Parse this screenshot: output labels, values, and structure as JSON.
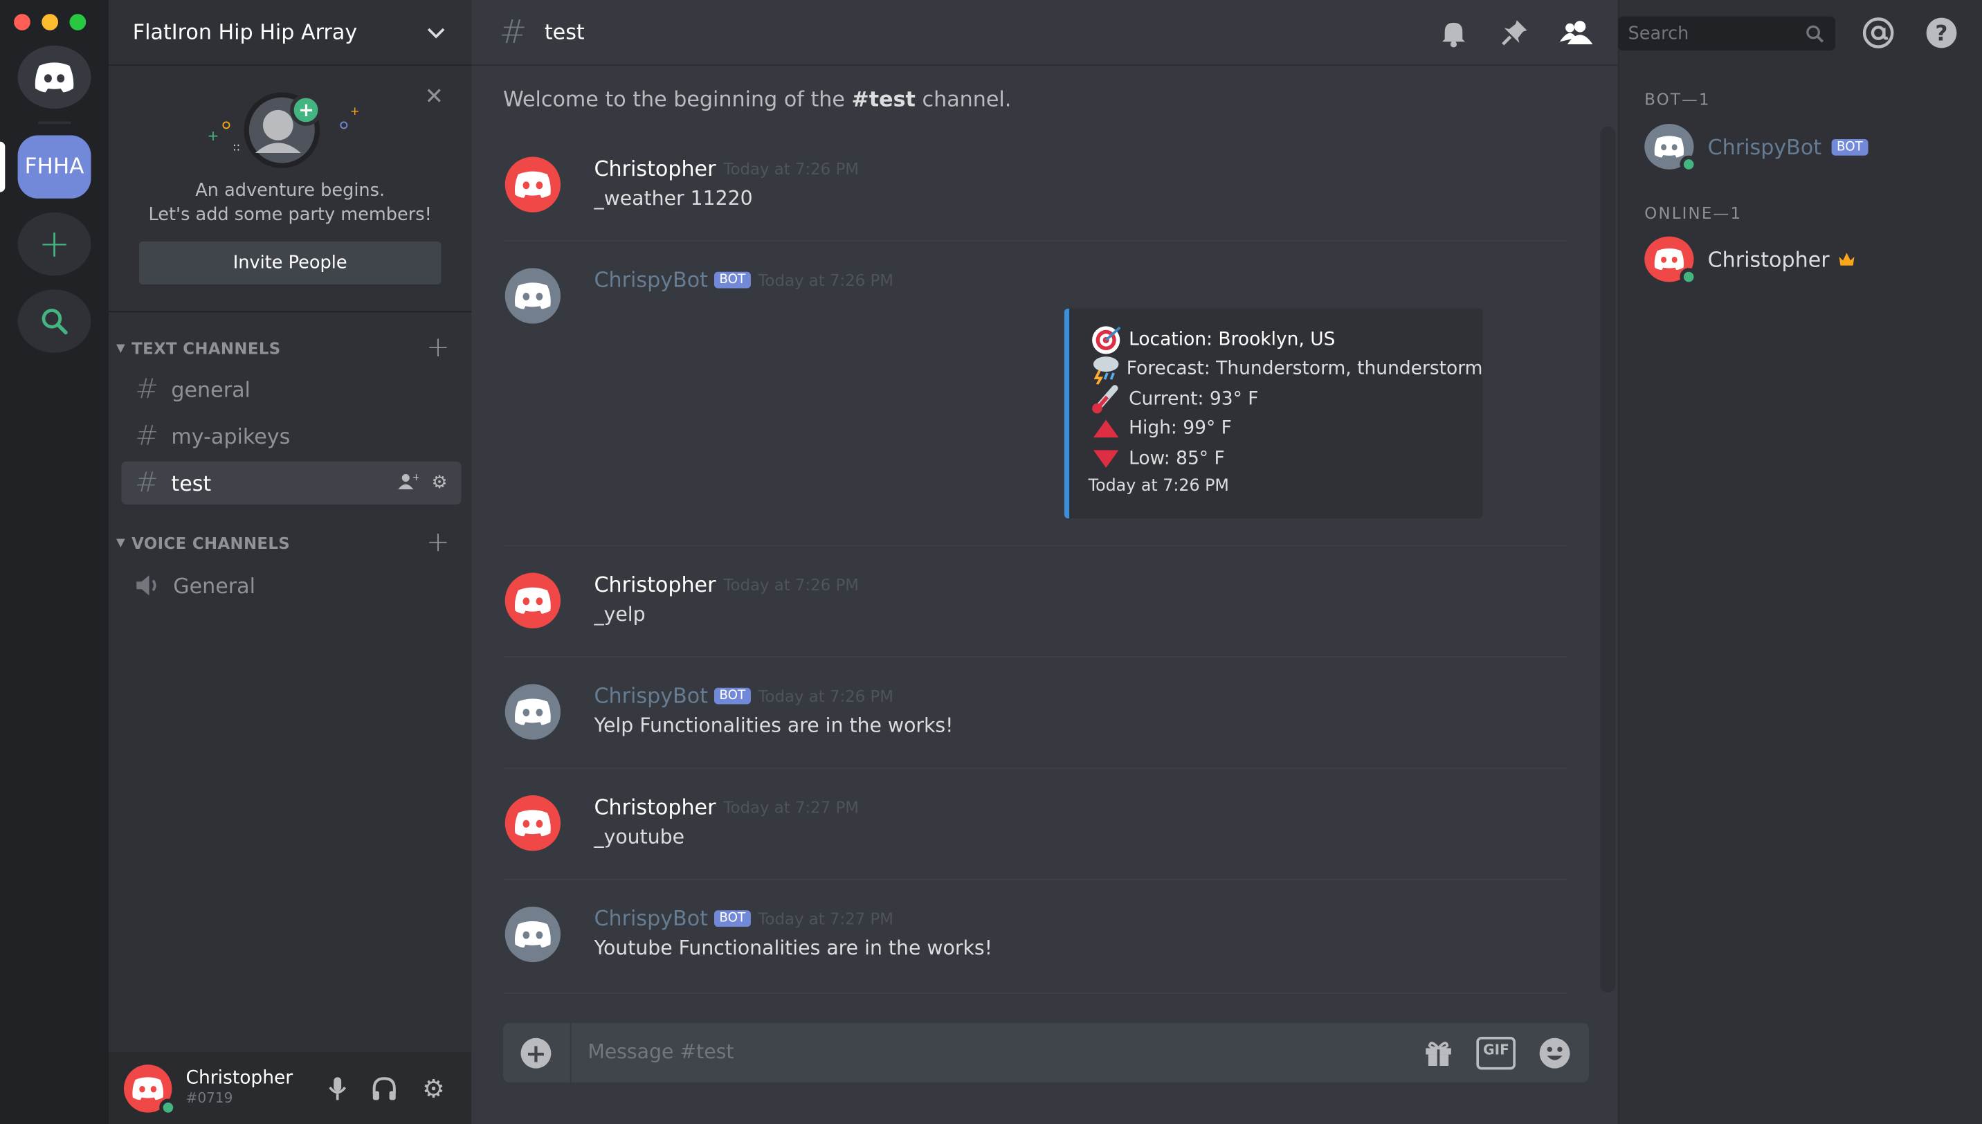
{
  "window": {
    "traffic_lights": [
      "close",
      "minimize",
      "zoom"
    ]
  },
  "servers": {
    "home_icon": "discord-logo-icon",
    "items": [
      {
        "label": "FHHA",
        "active": true
      }
    ],
    "add_icon": "plus-icon",
    "explore_icon": "search-icon"
  },
  "guild": {
    "name": "FlatIron Hip Hip Array",
    "invite": {
      "line1": "An adventure begins.",
      "line2": "Let's add some party members!",
      "button": "Invite People"
    },
    "categories": [
      {
        "label": "TEXT CHANNELS",
        "channels": [
          {
            "name": "general",
            "type": "text"
          },
          {
            "name": "my-apikeys",
            "type": "text"
          },
          {
            "name": "test",
            "type": "text",
            "active": true
          }
        ]
      },
      {
        "label": "VOICE CHANNELS",
        "channels": [
          {
            "name": "General",
            "type": "voice"
          }
        ]
      }
    ]
  },
  "user": {
    "name": "Christopher",
    "discriminator": "#0719"
  },
  "channel": {
    "name": "test",
    "search_placeholder": "Search",
    "welcome_prefix": "Welcome to the beginning of the ",
    "welcome_channel": "#test",
    "welcome_suffix": " channel."
  },
  "messages": [
    {
      "author": "Christopher",
      "bot": false,
      "time": "Today at 7:26 PM",
      "text": "_weather 11220"
    },
    {
      "author": "ChrispyBot",
      "bot": true,
      "badge": "BOT",
      "time": "Today at 7:26 PM",
      "text": "",
      "embed": {
        "lines": [
          {
            "icon": "target-icon",
            "text": "Location: Brooklyn, US"
          },
          {
            "icon": "thunderstorm-icon",
            "text": "Forecast: Thunderstorm, thunderstorm"
          },
          {
            "icon": "thermometer-icon",
            "text": "Current: 93° F"
          },
          {
            "icon": "triangle-up-icon",
            "text": "High: 99° F"
          },
          {
            "icon": "triangle-down-icon",
            "text": "Low: 85° F"
          }
        ],
        "footer": "Today at 7:26 PM",
        "color": "#3c8ed8"
      }
    },
    {
      "author": "Christopher",
      "bot": false,
      "time": "Today at 7:26 PM",
      "text": "_yelp"
    },
    {
      "author": "ChrispyBot",
      "bot": true,
      "badge": "BOT",
      "time": "Today at 7:26 PM",
      "text": "Yelp Functionalities are in the works!"
    },
    {
      "author": "Christopher",
      "bot": false,
      "time": "Today at 7:27 PM",
      "text": "_youtube"
    },
    {
      "author": "ChrispyBot",
      "bot": true,
      "badge": "BOT",
      "time": "Today at 7:27 PM",
      "text": "Youtube Functionalities are in the works!"
    }
  ],
  "composer": {
    "placeholder": "Message #test",
    "gif_label": "GIF"
  },
  "members": {
    "groups": [
      {
        "label": "BOT—1",
        "members": [
          {
            "name": "ChrispyBot",
            "badge": "BOT",
            "color": "#667c92"
          }
        ]
      },
      {
        "label": "ONLINE—1",
        "members": [
          {
            "name": "Christopher",
            "owner": true,
            "color": "#dcddde"
          }
        ]
      }
    ]
  },
  "colors": {
    "accent": "#7289da",
    "online": "#43b581",
    "user_avatar": "#f04747",
    "bot_avatar": "#747f8d"
  }
}
